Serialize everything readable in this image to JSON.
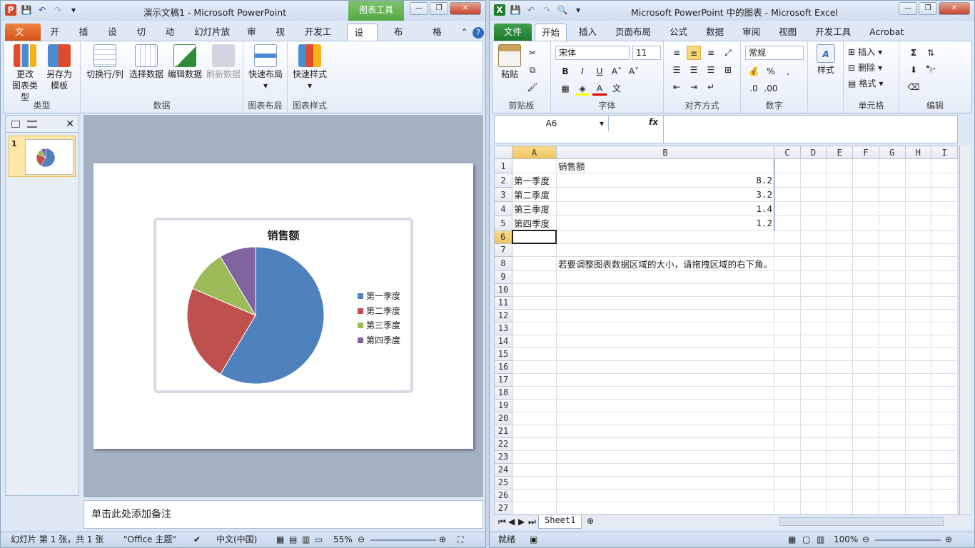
{
  "ppt": {
    "title": "演示文稿1  -  Microsoft PowerPoint",
    "context_tab": "图表工具",
    "tabs": [
      "文件",
      "开始",
      "插入",
      "设计",
      "切换",
      "动画",
      "幻灯片放映",
      "审阅",
      "视图",
      "开发工具",
      "设计",
      "布局",
      "格式"
    ],
    "ribbon": {
      "groups": [
        {
          "name": "类型",
          "buttons": [
            {
              "label": "更改\n图表类型"
            },
            {
              "label": "另存为\n模板"
            }
          ]
        },
        {
          "name": "数据",
          "buttons": [
            {
              "label": "切换行/列"
            },
            {
              "label": "选择数据"
            },
            {
              "label": "编辑数据"
            },
            {
              "label": "刷新数据"
            }
          ]
        },
        {
          "name": "图表布局",
          "buttons": [
            {
              "label": "快速布局"
            }
          ]
        },
        {
          "name": "图表样式",
          "buttons": [
            {
              "label": "快速样式"
            }
          ]
        }
      ]
    },
    "slide_number": "1",
    "notes_placeholder": "单击此处添加备注",
    "status": {
      "slide": "幻灯片 第 1 张，共 1 张",
      "theme": "\"Office 主题\"",
      "lang": "中文(中国)",
      "zoom": "55%"
    }
  },
  "chart_data": {
    "type": "pie",
    "title": "销售额",
    "categories": [
      "第一季度",
      "第二季度",
      "第三季度",
      "第四季度"
    ],
    "values": [
      8.2,
      3.2,
      1.4,
      1.2
    ],
    "colors": [
      "#4f81bd",
      "#c0504d",
      "#9bbb59",
      "#8064a2"
    ],
    "legend": "right"
  },
  "xls": {
    "title": "Microsoft PowerPoint 中的图表  -  Microsoft Excel",
    "tabs": [
      "文件",
      "开始",
      "插入",
      "页面布局",
      "公式",
      "数据",
      "审阅",
      "视图",
      "开发工具",
      "Acrobat"
    ],
    "ribbon": {
      "paste": "粘贴",
      "font_name": "宋体",
      "font_size": "11",
      "number_format": "常规",
      "styles": "样式",
      "insert": "插入",
      "delete": "删除",
      "format": "格式",
      "groups": [
        "剪贴板",
        "字体",
        "对齐方式",
        "数字",
        "单元格",
        "编辑"
      ]
    },
    "name_box": "A6",
    "fx": "fx",
    "columns": [
      "A",
      "B",
      "C",
      "D",
      "E",
      "F",
      "G",
      "H",
      "I"
    ],
    "rows": [
      [
        "销售额"
      ],
      [
        "第一季度",
        "8.2"
      ],
      [
        "第二季度",
        "3.2"
      ],
      [
        "第三季度",
        "1.4"
      ],
      [
        "第四季度",
        "1.2"
      ],
      [],
      [],
      [
        "若要调整图表数据区域的大小，请拖拽区域的右下角。"
      ]
    ],
    "row_count": 28,
    "sheet_tab": "Sheet1",
    "status": {
      "ready": "就绪",
      "zoom": "100%"
    }
  }
}
